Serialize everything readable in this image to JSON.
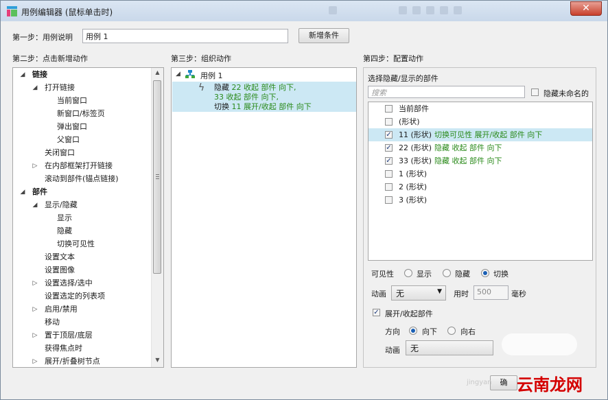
{
  "window": {
    "title": "用例编辑器 (鼠标单击时)",
    "close_glyph": "✕"
  },
  "step1": {
    "label": "第一步：用例说明",
    "value": "用例 1",
    "add_condition": "新增条件"
  },
  "step2": {
    "label": "第二步：点击新增动作",
    "items": [
      {
        "label": "链接",
        "expander": "◢",
        "bold": true
      },
      {
        "label": "打开链接",
        "expander": "◢"
      },
      {
        "label": "当前窗口"
      },
      {
        "label": "新窗口/标签页"
      },
      {
        "label": "弹出窗口"
      },
      {
        "label": "父窗口"
      },
      {
        "label": "关闭窗口"
      },
      {
        "label": "在内部框架打开链接",
        "expander": "▷"
      },
      {
        "label": "滚动到部件(锚点链接)"
      },
      {
        "label": "部件",
        "expander": "◢",
        "bold": true
      },
      {
        "label": "显示/隐藏",
        "expander": "◢"
      },
      {
        "label": "显示"
      },
      {
        "label": "隐藏"
      },
      {
        "label": "切换可见性"
      },
      {
        "label": "设置文本"
      },
      {
        "label": "设置图像"
      },
      {
        "label": "设置选择/选中",
        "expander": "▷"
      },
      {
        "label": "设置选定的列表项"
      },
      {
        "label": "启用/禁用",
        "expander": "▷"
      },
      {
        "label": "移动"
      },
      {
        "label": "置于顶层/底层",
        "expander": "▷"
      },
      {
        "label": "获得焦点时"
      },
      {
        "label": "展开/折叠树节点",
        "expander": "▷"
      }
    ],
    "scroll_up": "▲",
    "scroll_down": "▼"
  },
  "step3": {
    "label": "第三步：组织动作",
    "case_expander": "◢",
    "case_name": "用例 1",
    "action": {
      "line1_verb": "隐藏",
      "line1_rest": "22 收起 部件 向下,",
      "line2": "33 收起 部件 向下,",
      "line3_verb": "切换",
      "line3_rest": "11 展开/收起 部件 向下"
    }
  },
  "step4": {
    "label": "第四步：配置动作",
    "section_label": "选择隐藏/显示的部件",
    "search_placeholder": "搜索",
    "hide_unnamed": "隐藏未命名的",
    "widgets": [
      {
        "name": "当前部件",
        "detail": "",
        "checked": false,
        "selected": false
      },
      {
        "name": "(形状)",
        "detail": "",
        "checked": false,
        "selected": false
      },
      {
        "name": "11 (形状)",
        "detail": "切换可见性 展开/收起 部件 向下",
        "checked": true,
        "selected": true
      },
      {
        "name": "22 (形状)",
        "detail": "隐藏 收起 部件 向下",
        "checked": true,
        "selected": false
      },
      {
        "name": "33 (形状)",
        "detail": "隐藏 收起 部件 向下",
        "checked": true,
        "selected": false
      },
      {
        "name": "1 (形状)",
        "detail": "",
        "checked": false,
        "selected": false
      },
      {
        "name": "2 (形状)",
        "detail": "",
        "checked": false,
        "selected": false
      },
      {
        "name": "3 (形状)",
        "detail": "",
        "checked": false,
        "selected": false
      }
    ],
    "visibility_label": "可见性",
    "visibility_options": [
      "显示",
      "隐藏",
      "切换"
    ],
    "visibility_selected": "切换",
    "animation_label": "动画",
    "animation_value": "无",
    "duration_label": "用时",
    "duration_value": "500",
    "duration_unit": "毫秒",
    "expand_collapse_label": "展开/收起部件",
    "expand_collapse_checked": true,
    "direction_label": "方向",
    "direction_options": [
      "向下",
      "向右"
    ],
    "direction_selected": "向下",
    "anim2_label": "动画",
    "anim2_value": "无"
  },
  "footer": {
    "ok_partial": "确"
  },
  "watermark": {
    "text": "云南龙网",
    "faint": "jingyan"
  },
  "colors": {
    "accent_green": "#2a8a1a",
    "selection": "#cce8f4"
  }
}
